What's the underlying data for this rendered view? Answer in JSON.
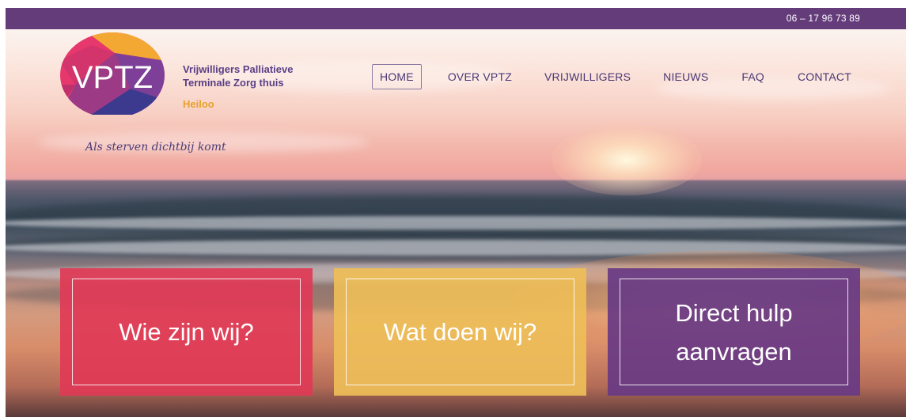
{
  "topbar": {
    "phone": "06 – 17 96 73 89"
  },
  "logo": {
    "mark": "VPTZ",
    "line1": "Vrijwilligers Palliatieve",
    "line2": "Terminale Zorg thuis",
    "place": "Heiloo",
    "tagline": "Als sterven dichtbij komt"
  },
  "nav": {
    "items": [
      {
        "label": "HOME",
        "active": true
      },
      {
        "label": "OVER VPTZ",
        "active": false
      },
      {
        "label": "VRIJWILLIGERS",
        "active": false
      },
      {
        "label": "NIEUWS",
        "active": false
      },
      {
        "label": "FAQ",
        "active": false
      },
      {
        "label": "CONTACT",
        "active": false
      }
    ]
  },
  "cards": [
    {
      "label": "Wie zijn wij?",
      "color": "#e03a56"
    },
    {
      "label": "Wat doen wij?",
      "color": "#eebe58"
    },
    {
      "label": "Direct hulp aanvragen",
      "color": "#683a84"
    }
  ]
}
